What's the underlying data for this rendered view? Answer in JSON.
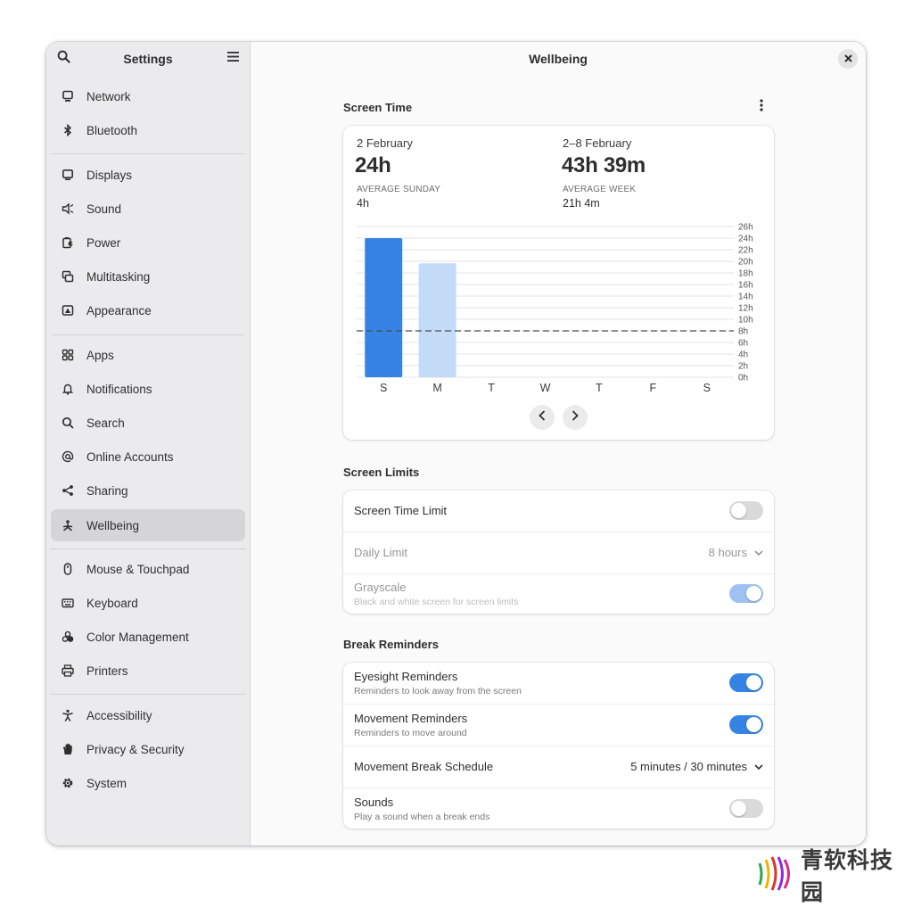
{
  "sidebar": {
    "title": "Settings",
    "groups": [
      [
        {
          "label": "Network",
          "icon": "network-icon"
        },
        {
          "label": "Bluetooth",
          "icon": "bluetooth-icon"
        }
      ],
      [
        {
          "label": "Displays",
          "icon": "display-icon"
        },
        {
          "label": "Sound",
          "icon": "sound-icon"
        },
        {
          "label": "Power",
          "icon": "power-icon"
        },
        {
          "label": "Multitasking",
          "icon": "multitasking-icon"
        },
        {
          "label": "Appearance",
          "icon": "appearance-icon"
        }
      ],
      [
        {
          "label": "Apps",
          "icon": "apps-icon"
        },
        {
          "label": "Notifications",
          "icon": "bell-icon"
        },
        {
          "label": "Search",
          "icon": "search-icon"
        },
        {
          "label": "Online Accounts",
          "icon": "at-icon"
        },
        {
          "label": "Sharing",
          "icon": "share-icon"
        },
        {
          "label": "Wellbeing",
          "icon": "wellbeing-icon",
          "selected": true
        }
      ],
      [
        {
          "label": "Mouse & Touchpad",
          "icon": "mouse-icon"
        },
        {
          "label": "Keyboard",
          "icon": "keyboard-icon"
        },
        {
          "label": "Color Management",
          "icon": "color-icon"
        },
        {
          "label": "Printers",
          "icon": "printer-icon"
        }
      ],
      [
        {
          "label": "Accessibility",
          "icon": "accessibility-icon"
        },
        {
          "label": "Privacy & Security",
          "icon": "hand-icon"
        },
        {
          "label": "System",
          "icon": "gear-icon"
        }
      ]
    ]
  },
  "page": {
    "title": "Wellbeing"
  },
  "screen_time": {
    "section_title": "Screen Time",
    "day": {
      "date": "2 February",
      "total": "24h",
      "avg_caption": "AVERAGE SUNDAY",
      "avg_value": "4h"
    },
    "week": {
      "date": "2–8 February",
      "total": "43h 39m",
      "avg_caption": "AVERAGE WEEK",
      "avg_value": "21h 4m"
    }
  },
  "chart_data": {
    "type": "bar",
    "categories": [
      "S",
      "M",
      "T",
      "W",
      "T",
      "F",
      "S"
    ],
    "values": [
      24,
      19.65,
      0,
      0,
      0,
      0,
      0
    ],
    "highlight_index": 0,
    "average_line": 8,
    "ylim": [
      0,
      26
    ],
    "y_ticks": [
      "0h",
      "2h",
      "4h",
      "6h",
      "8h",
      "10h",
      "12h",
      "14h",
      "16h",
      "18h",
      "20h",
      "22h",
      "24h",
      "26h"
    ],
    "colors": {
      "highlight": "#3584e4",
      "normal": "#c4dbf8",
      "average": "#4a4a4a",
      "grid": "#e3e3e3"
    },
    "grid": true
  },
  "screen_limits": {
    "section_title": "Screen Limits",
    "screen_time_limit": {
      "label": "Screen Time Limit",
      "enabled": false
    },
    "daily_limit": {
      "label": "Daily Limit",
      "value": "8 hours"
    },
    "grayscale": {
      "label": "Grayscale",
      "subtitle": "Black and white screen for screen limits",
      "enabled": true
    }
  },
  "break_reminders": {
    "section_title": "Break Reminders",
    "eyesight": {
      "label": "Eyesight Reminders",
      "subtitle": "Reminders to look away from the screen",
      "enabled": true
    },
    "movement": {
      "label": "Movement Reminders",
      "subtitle": "Reminders to move around",
      "enabled": true
    },
    "schedule": {
      "label": "Movement Break Schedule",
      "value": "5 minutes / 30 minutes"
    },
    "sounds": {
      "label": "Sounds",
      "subtitle": "Play a sound when a break ends",
      "enabled": false
    }
  },
  "watermark": {
    "text": "青软科技园"
  },
  "colors": {
    "accent": "#3584e4",
    "sidebar_bg": "#ebebed",
    "selected_bg": "#d5d5d7"
  }
}
